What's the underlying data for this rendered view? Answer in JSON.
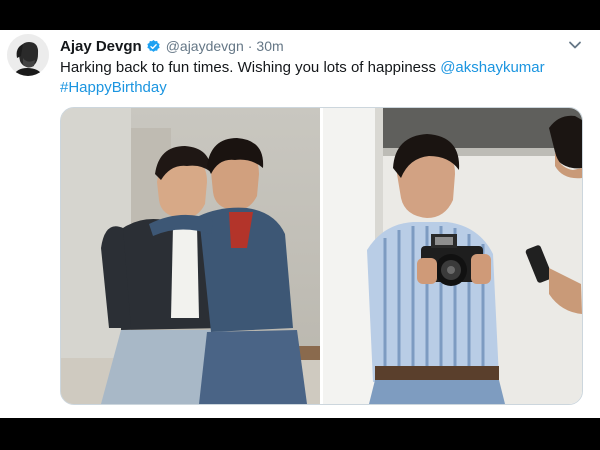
{
  "tweet": {
    "author_name": "Ajay Devgn",
    "handle": "@ajaydevgn",
    "separator": "·",
    "timestamp": "30m",
    "text": "Harking back to fun times. Wishing you lots of happiness ",
    "mention": "@akshaykumar",
    "hashtag": "#HappyBirthday",
    "icons": {
      "verified": "verified-badge-icon",
      "more": "chevron-down-icon"
    },
    "colors": {
      "link": "#1b95e0",
      "text": "#14171a",
      "secondary": "#657786"
    }
  }
}
